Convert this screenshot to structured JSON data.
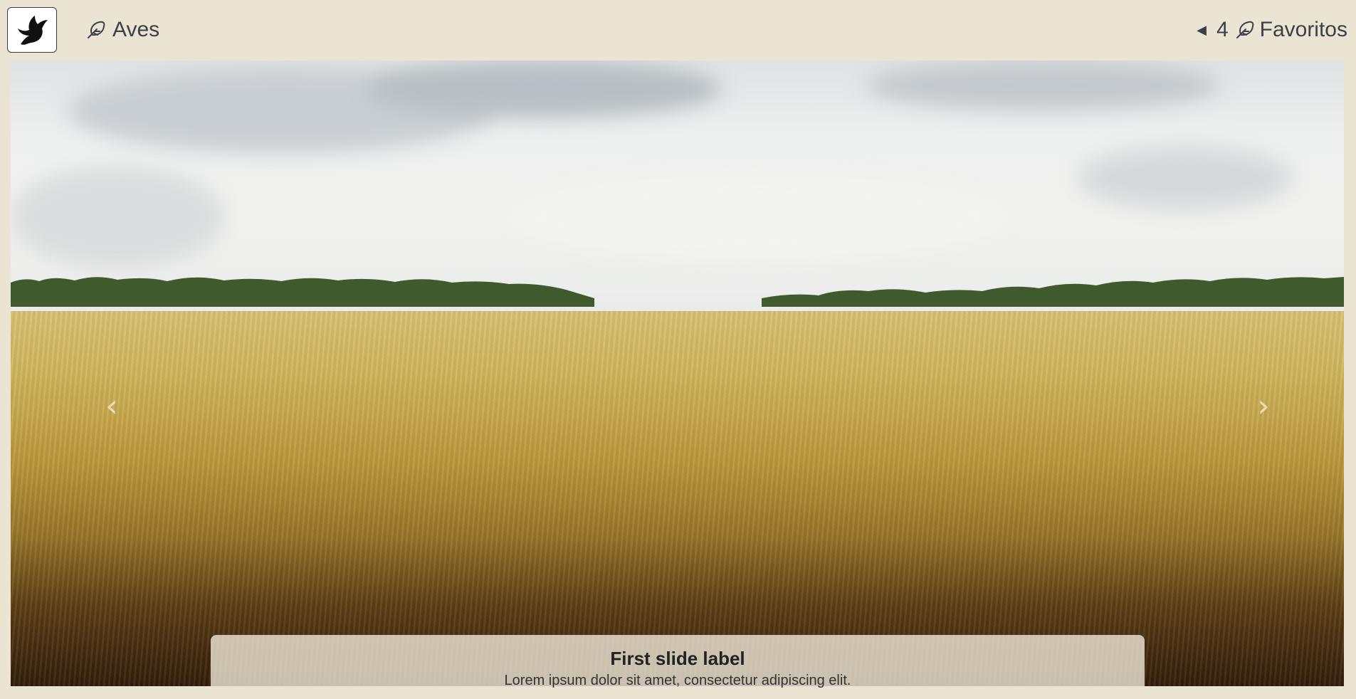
{
  "navbar": {
    "brand_icon": "bird-silhouette-icon",
    "aves_label": "Aves",
    "aves_icon": "feather-icon",
    "favorites_caret": "caret-left-icon",
    "favorites_count": "4",
    "favorites_icon": "feather-icon",
    "favorites_label": "Favoritos"
  },
  "carousel": {
    "prev_glyph": "‹",
    "next_glyph": "›",
    "slide_image": "wheat-field-landscape",
    "caption_title": "First slide label",
    "caption_text": "Lorem ipsum dolor sit amet, consectetur adipiscing elit."
  },
  "colors": {
    "background": "#ebe4d3",
    "text": "#3b4048"
  }
}
